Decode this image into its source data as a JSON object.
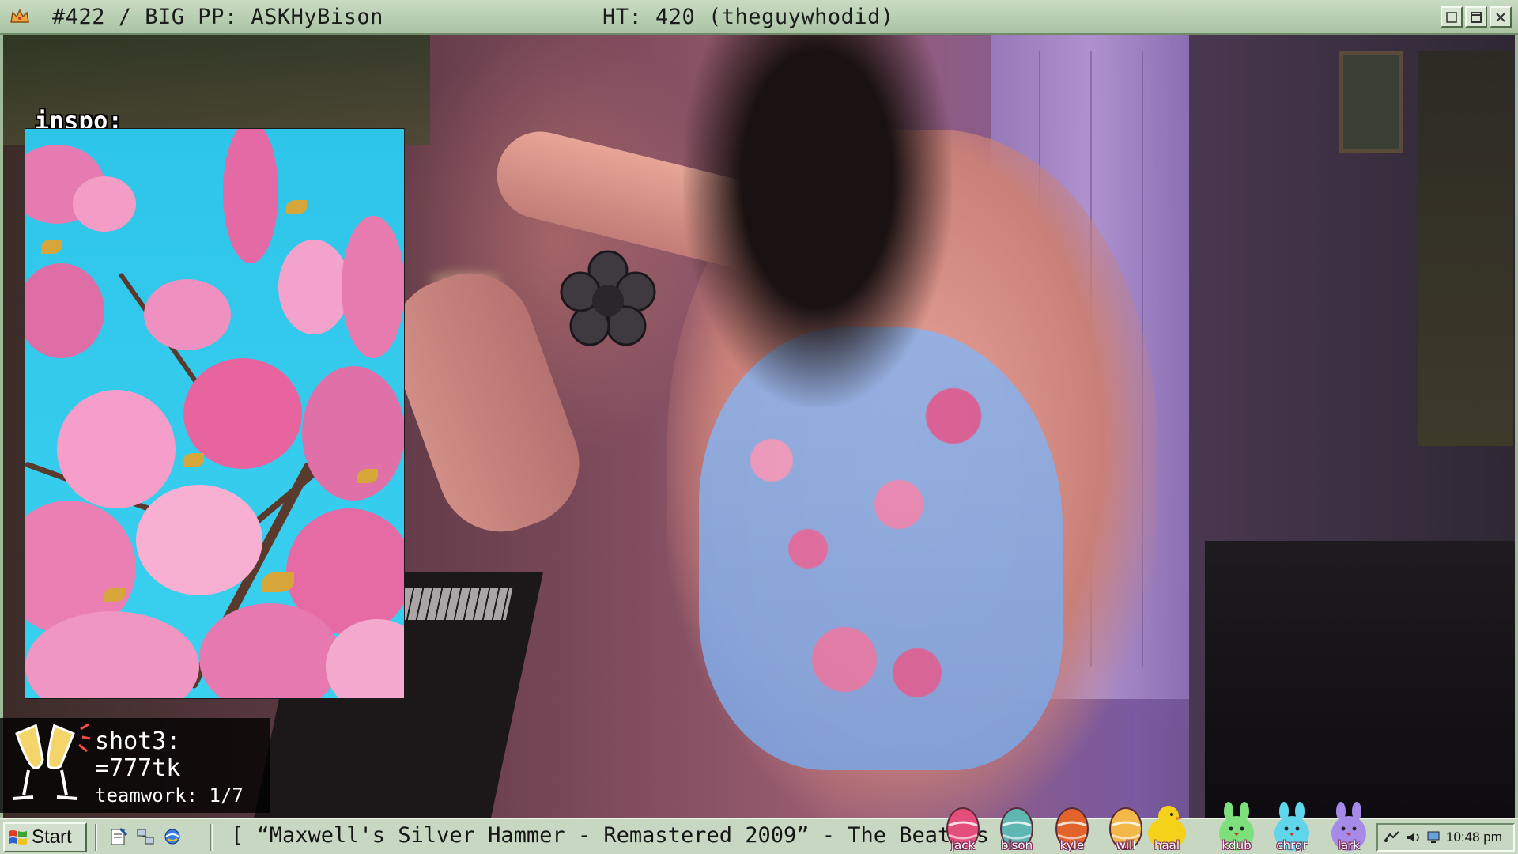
{
  "window": {
    "title_left": "#422 / BIG PP: ASKHyBison",
    "title_center": "HT: 420 (theguywhodid)",
    "app_icon": "crown-icon"
  },
  "overlay": {
    "inspo_label": "inspo:",
    "goal": {
      "title": "shot3:",
      "amount": "=777tk",
      "subtitle": "teamwork: 1/7",
      "icon": "champagne-icon"
    }
  },
  "taskbar": {
    "start_label": "Start",
    "now_playing": "[ “Maxwell's Silver Hammer - Remastered 2009” - The Beatles",
    "clock": "10:48 pm",
    "mascots": [
      {
        "name": "jack",
        "kind": "egg",
        "color": "#e34f7a"
      },
      {
        "name": "bison",
        "kind": "egg",
        "color": "#5fb7b3"
      },
      {
        "name": "kyle",
        "kind": "egg",
        "color": "#e2642a"
      },
      {
        "name": "will",
        "kind": "egg",
        "color": "#f2b84a"
      },
      {
        "name": "haal",
        "kind": "chick",
        "color": "#f5d21a"
      },
      {
        "name": "kdub",
        "kind": "bunny",
        "color": "#7ee07c"
      },
      {
        "name": "chrgr",
        "kind": "bunny",
        "color": "#5fd6ea"
      },
      {
        "name": "lark",
        "kind": "bunny",
        "color": "#a68ae8"
      }
    ]
  },
  "colors": {
    "frame": "#c7d7c2",
    "sky": "#2ec5ea",
    "blossom": "#e86aa6"
  }
}
